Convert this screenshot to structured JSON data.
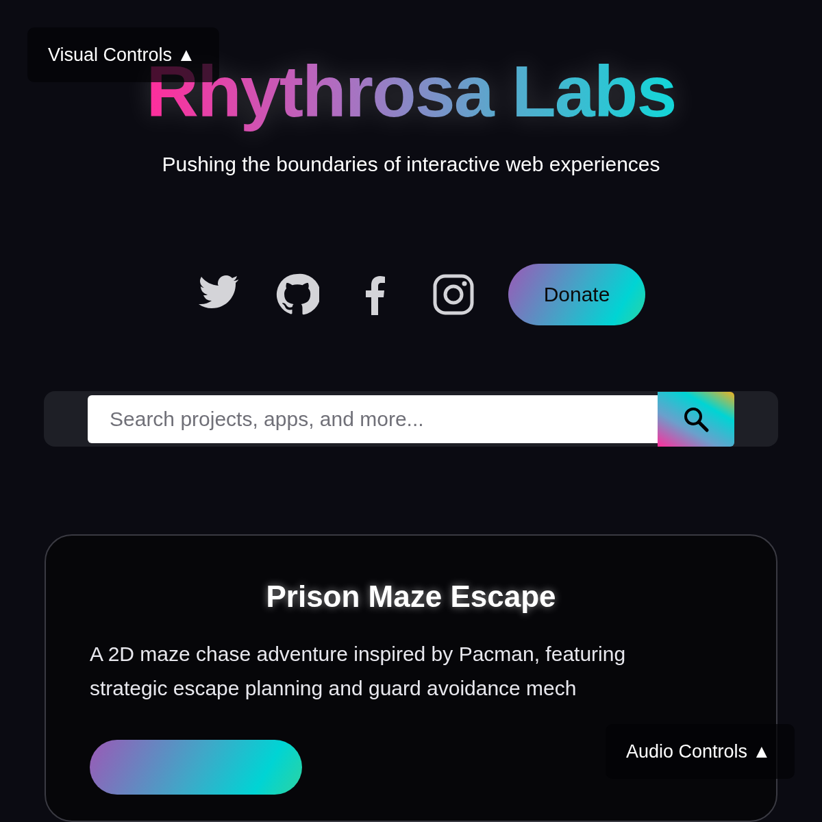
{
  "visual_controls": {
    "label": "Visual Controls ▲"
  },
  "header": {
    "title": "Rhythrosa Labs",
    "tagline": "Pushing the boundaries of interactive web experiences"
  },
  "social": {
    "links": [
      {
        "kind": "twitter"
      },
      {
        "kind": "github"
      },
      {
        "kind": "facebook"
      },
      {
        "kind": "instagram"
      }
    ],
    "donate": "Donate"
  },
  "search": {
    "placeholder": "Search projects, apps, and more..."
  },
  "project": {
    "title": "Prison Maze Escape",
    "description": "A 2D maze chase adventure inspired by Pacman, featuring strategic escape planning and guard avoidance mech"
  },
  "audio_controls": {
    "label": "Audio Controls ▲"
  }
}
